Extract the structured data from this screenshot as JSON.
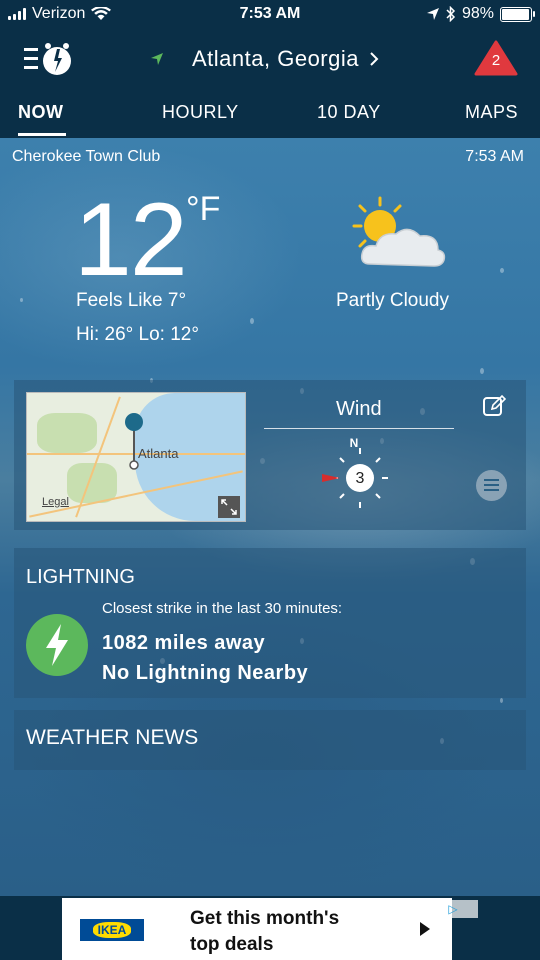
{
  "status_bar": {
    "carrier": "Verizon",
    "time": "7:53 AM",
    "battery": "98%"
  },
  "header": {
    "location": "Atlanta, Georgia",
    "alert_count": "2"
  },
  "tabs": [
    {
      "label": "NOW",
      "active": true
    },
    {
      "label": "HOURLY",
      "active": false
    },
    {
      "label": "10 DAY",
      "active": false
    },
    {
      "label": "MAPS",
      "active": false
    }
  ],
  "current": {
    "station": "Cherokee Town Club",
    "observed_time": "7:53 AM",
    "temperature": "12",
    "unit": "°F",
    "feels_like": "Feels Like  7°",
    "hi_lo": "Hi: 26°  Lo: 12°",
    "condition": "Partly Cloudy",
    "condition_icon": "partly-cloudy-icon"
  },
  "map_card": {
    "city_label": "Atlanta",
    "legal": "Legal"
  },
  "wind": {
    "title": "Wind",
    "direction": "N",
    "speed": "3"
  },
  "lightning": {
    "title": "LIGHTNING",
    "closest_label": "Closest strike in the last 30 minutes:",
    "distance": "1082 miles away",
    "status": "No Lightning Nearby"
  },
  "news": {
    "title": "WEATHER NEWS"
  },
  "ad": {
    "brand": "IKEA",
    "line1": "Get this month's",
    "line2": "top deals",
    "adchoices": "▷"
  },
  "colors": {
    "header_bg": "#0a2f47",
    "alert_red": "#e0393e",
    "lightning_green": "#5cb85c",
    "ikea_blue": "#004b96",
    "ikea_yellow": "#ffdb00"
  }
}
